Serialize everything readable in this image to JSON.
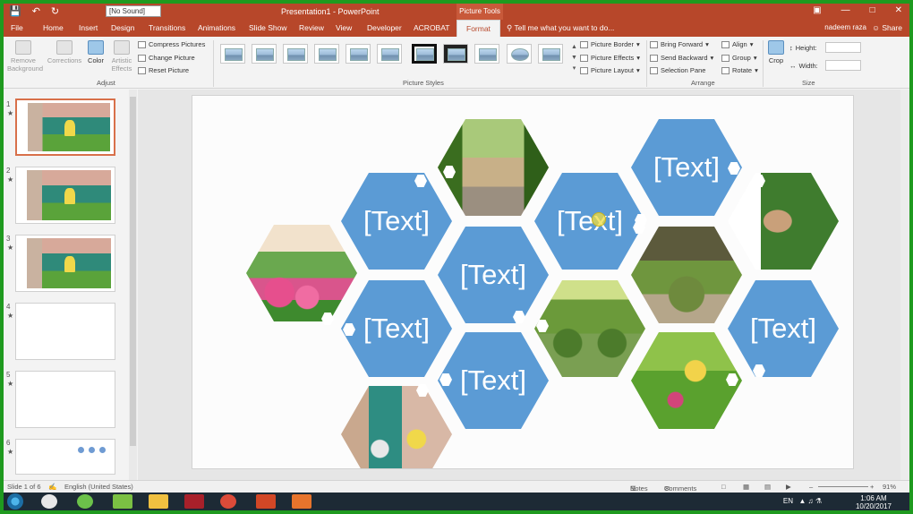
{
  "titlebar": {
    "sound_select": "[No Sound]",
    "title": "Presentation1 - PowerPoint",
    "context_group": "Picture Tools"
  },
  "tabs": {
    "items": [
      "File",
      "Home",
      "Insert",
      "Design",
      "Transitions",
      "Animations",
      "Slide Show",
      "Review",
      "View",
      "Developer",
      "ACROBAT",
      "Format"
    ],
    "active": "Format",
    "tell_me": "Tell me what you want to do...",
    "user": "nadeem raza",
    "share": "Share"
  },
  "ribbon": {
    "adjust": {
      "remove_background": "Remove Background",
      "corrections": "Corrections",
      "color": "Color",
      "artistic_effects": "Artistic Effects",
      "compress": "Compress Pictures",
      "change": "Change Picture",
      "reset": "Reset Picture",
      "label": "Adjust"
    },
    "picture_styles": {
      "border": "Picture Border",
      "effects": "Picture Effects",
      "layout": "Picture Layout",
      "label": "Picture Styles"
    },
    "arrange": {
      "bring_forward": "Bring Forward",
      "send_backward": "Send Backward",
      "selection_pane": "Selection Pane",
      "align": "Align",
      "group": "Group",
      "rotate": "Rotate",
      "label": "Arrange"
    },
    "size": {
      "crop": "Crop",
      "height": "Height:",
      "width": "Width:",
      "label": "Size"
    }
  },
  "thumbnails": [
    "1",
    "2",
    "3",
    "4",
    "5",
    "6"
  ],
  "slide": {
    "placeholder_text": "[Text]"
  },
  "status": {
    "slide_of": "Slide 1 of 6",
    "language": "English (United States)",
    "notes": "Notes",
    "comments": "Comments",
    "zoom": "91%"
  },
  "taskbar": {
    "lang": "EN",
    "time": "1:06 AM",
    "date": "10/20/2017"
  },
  "colors": {
    "accent": "#b7472a",
    "hex_fill": "#5b9bd5"
  }
}
